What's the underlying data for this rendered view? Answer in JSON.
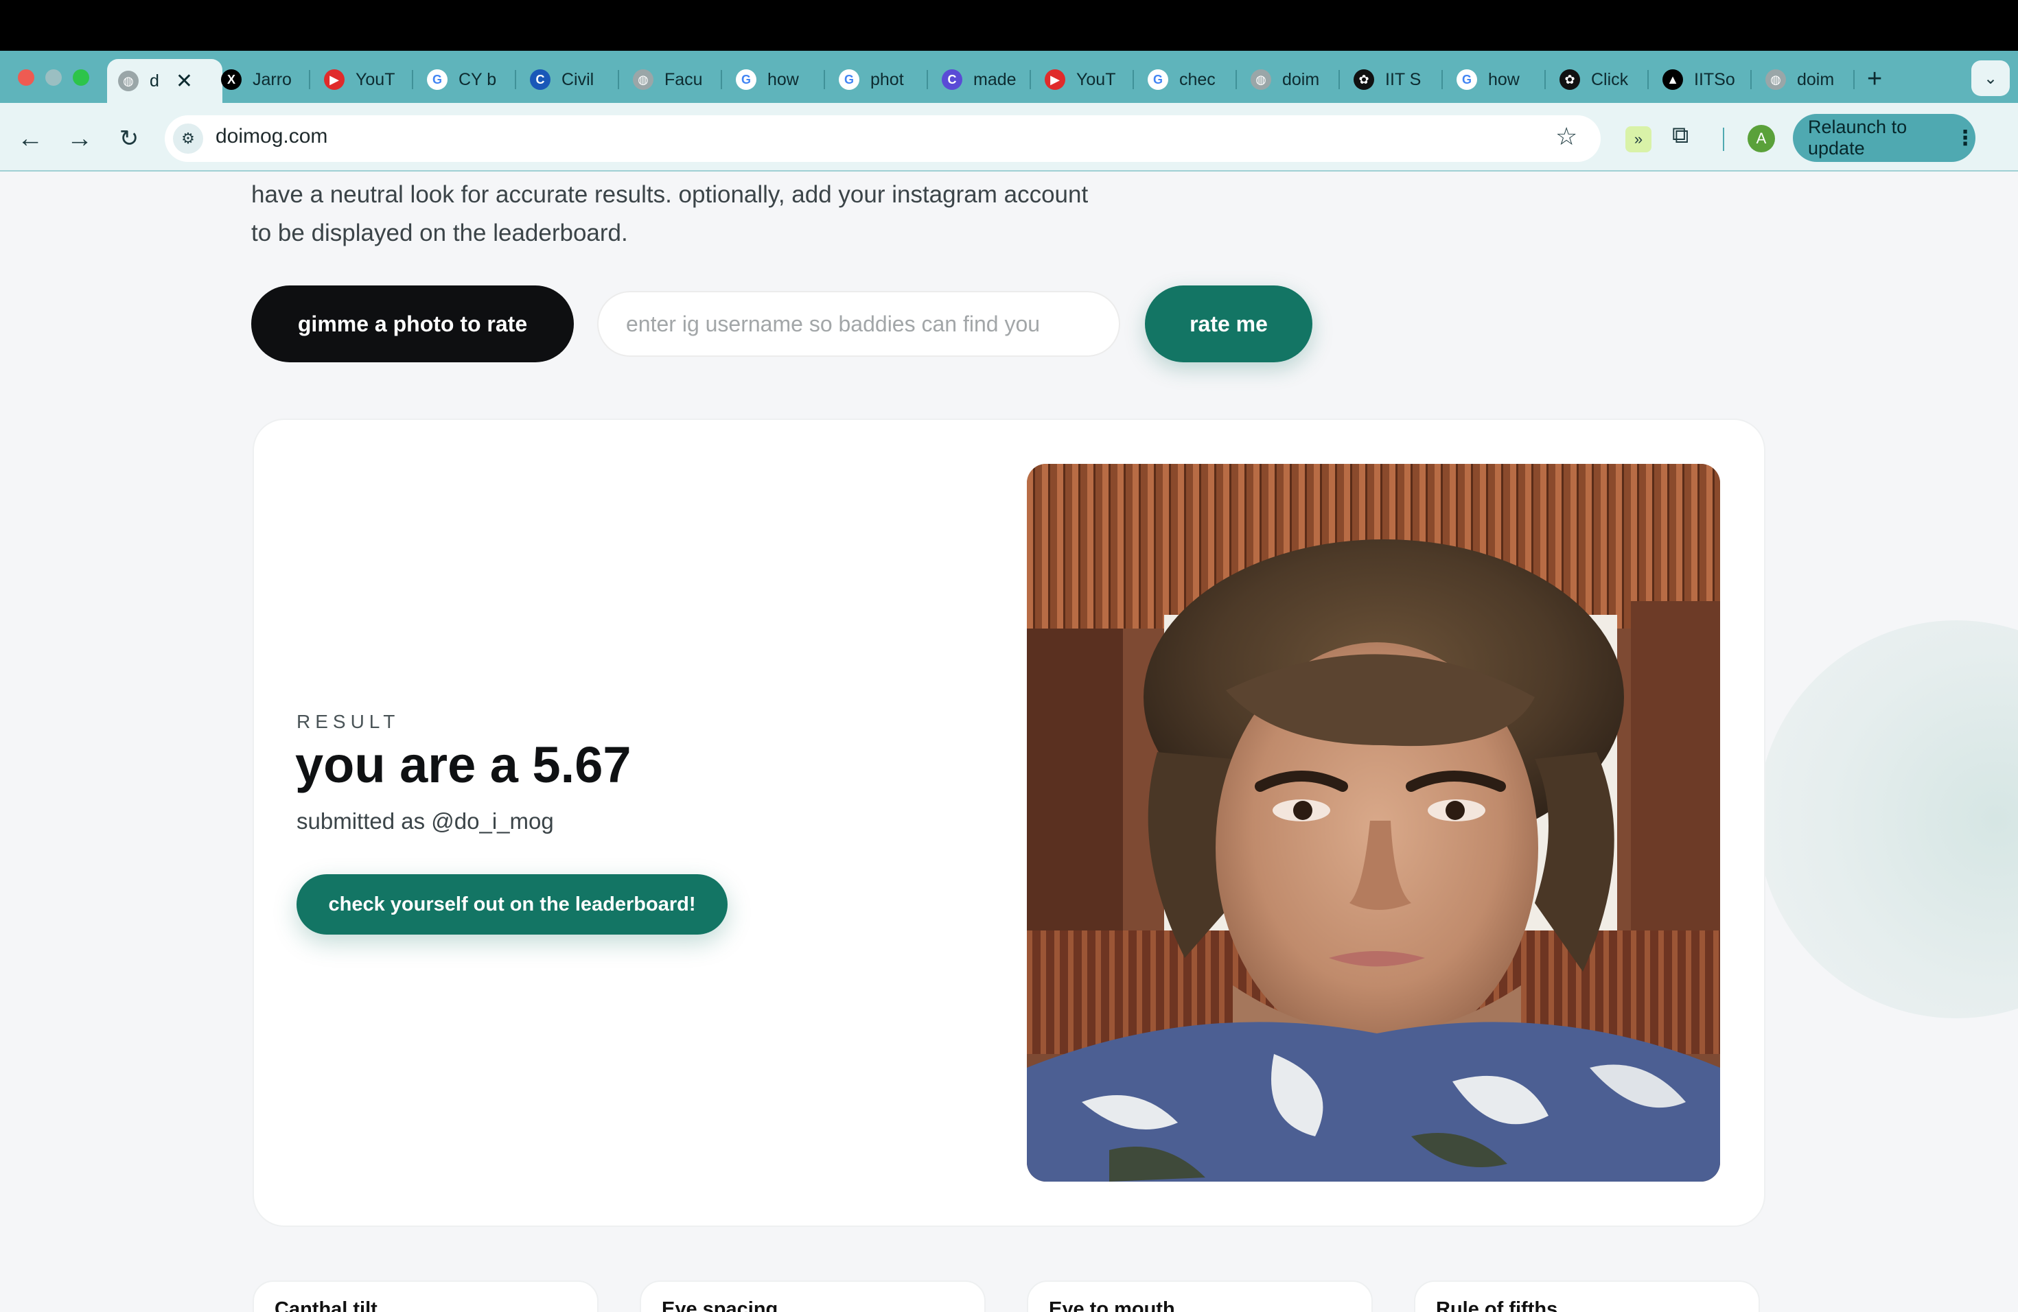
{
  "browser": {
    "active_tab_title": "d",
    "tabs": [
      {
        "title": "Jarro",
        "icon": "x-logo-icon"
      },
      {
        "title": "YouT",
        "icon": "youtube-icon"
      },
      {
        "title": "CY b",
        "icon": "google-icon"
      },
      {
        "title": "Civil",
        "icon": "ced-iitd-icon"
      },
      {
        "title": "Facu",
        "icon": "site-icon"
      },
      {
        "title": "how",
        "icon": "google-icon"
      },
      {
        "title": "phot",
        "icon": "google-icon"
      },
      {
        "title": "made",
        "icon": "canva-icon"
      },
      {
        "title": "YouT",
        "icon": "youtube-icon"
      },
      {
        "title": "chec",
        "icon": "google-icon"
      },
      {
        "title": "doim",
        "icon": "site-icon"
      },
      {
        "title": "IIT S",
        "icon": "chatgpt-icon"
      },
      {
        "title": "how",
        "icon": "google-icon"
      },
      {
        "title": "Click",
        "icon": "chatgpt-icon"
      },
      {
        "title": "IITSo",
        "icon": "vercel-icon"
      },
      {
        "title": "doim",
        "icon": "site-icon"
      }
    ],
    "new_tab": "+",
    "url": "doimog.com",
    "profile_initial": "A",
    "relaunch_label": "Relaunch to update"
  },
  "page": {
    "intro_line1": "have a neutral look for accurate results. optionally, add your instagram account",
    "intro_line2": "to be displayed on the leaderboard.",
    "photo_button": "gimme a photo to rate",
    "ig_placeholder": "enter ig username so baddies can find you",
    "rate_button": "rate me",
    "result_label": "RESULT",
    "score_text": "you are a 5.67",
    "submitted_text": "submitted as @do_i_mog",
    "leaderboard_button": "check yourself out on the leaderboard!",
    "metrics": [
      "Canthal tilt",
      "Eye spacing",
      "Eye to mouth",
      "Rule of fifths"
    ]
  },
  "colors": {
    "accent": "#137564",
    "tab_strip": "#5fb4bb",
    "toolbar": "#e8f4f5"
  }
}
